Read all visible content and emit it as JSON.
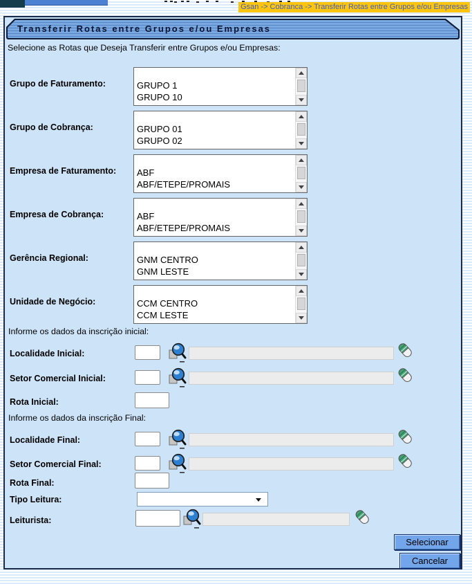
{
  "header": {
    "breadcrumb": "Gsan -> Cobranca -> Transferir Rotas entre Grupos e/ou Empresas"
  },
  "page": {
    "title": "Transferir Rotas entre Grupos e/ou Empresas",
    "intro": "Selecione as Rotas que Deseja Transferir entre Grupos e/ou Empresas:"
  },
  "listboxes": [
    {
      "label": "Grupo de Faturamento:",
      "items": [
        "GRUPO 1",
        "GRUPO 10"
      ]
    },
    {
      "label": "Grupo de Cobrança:",
      "items": [
        "GRUPO 01",
        "GRUPO 02"
      ]
    },
    {
      "label": "Empresa de Faturamento:",
      "items": [
        "ABF",
        "ABF/ETEPE/PROMAIS"
      ]
    },
    {
      "label": "Empresa de Cobrança:",
      "items": [
        "ABF",
        "ABF/ETEPE/PROMAIS"
      ]
    },
    {
      "label": "Gerência Regional:",
      "items": [
        "GNM CENTRO",
        "GNM LESTE"
      ]
    },
    {
      "label": "Unidade de Negócio:",
      "items": [
        "CCM CENTRO",
        "CCM LESTE"
      ]
    }
  ],
  "inscricao_inicial": {
    "header": "Informe os dados da inscrição inicial:",
    "localidade": {
      "label": "Localidade Inicial:",
      "code_value": "",
      "name_value": ""
    },
    "setor": {
      "label": "Setor Comercial Inicial:",
      "code_value": "",
      "name_value": ""
    },
    "rota": {
      "label": "Rota Inicial:",
      "value": ""
    }
  },
  "inscricao_final": {
    "header": "Informe os dados da inscrição Final:",
    "localidade": {
      "label": "Localidade Final:",
      "code_value": "",
      "name_value": ""
    },
    "setor": {
      "label": "Setor Comercial Final:",
      "code_value": "",
      "name_value": ""
    },
    "rota": {
      "label": "Rota Final:",
      "value": ""
    },
    "tipo_leitura": {
      "label": "Tipo Leitura:",
      "selected_value": ""
    },
    "leiturista": {
      "label": "Leiturista:",
      "code_value": "",
      "name_value": ""
    }
  },
  "buttons": {
    "selecionar": "Selecionar",
    "cancelar": "Cancelar"
  },
  "icons": {
    "search": "magnifier",
    "clear": "eraser"
  },
  "colors": {
    "breadcrumb_bg": "#ffc40d",
    "breadcrumb_text": "#3a5fc8",
    "titlebar_blue": "#79a9e0",
    "content_bg": "#cde4f8",
    "button_bg": "#72a5e9",
    "eraser_green": "#44a176",
    "lens_blue": "#2f7fd0"
  }
}
